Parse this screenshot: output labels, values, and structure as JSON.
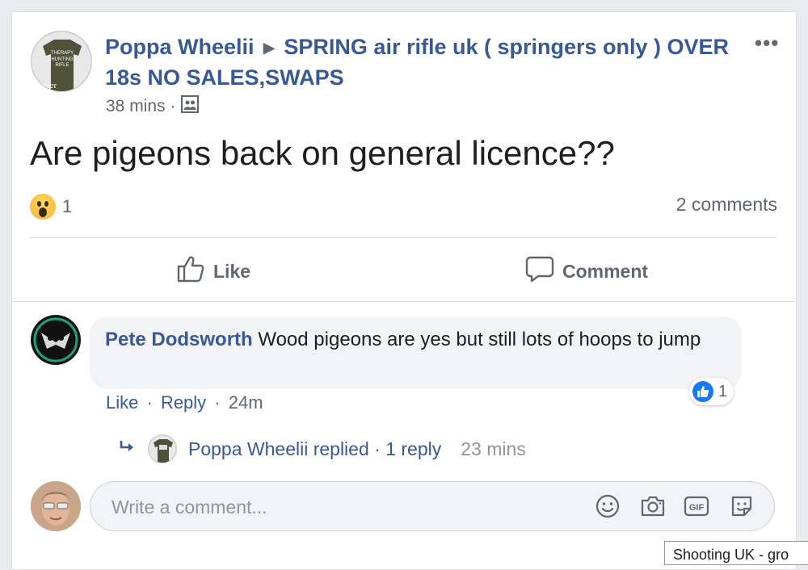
{
  "post": {
    "author": "Poppa Wheelii",
    "group": "SPRING air rifle uk ( springers only ) OVER 18s NO SALES,SWAPS",
    "time": "38 mins",
    "separator": "·",
    "text": "Are pigeons back on general licence??",
    "reaction_icon": "wow-emoji",
    "reaction_count": "1",
    "comment_count": "2 comments",
    "more_icon": "ellipsis-icon",
    "audience_icon": "group-members-icon",
    "author_avatar_text": [
      "THERAPY",
      "HUNTING",
      "RIFLE",
      "nter"
    ]
  },
  "actions": {
    "like_label": "Like",
    "comment_label": "Comment"
  },
  "comment": {
    "author": "Pete Dodsworth",
    "text": "Wood pigeons are yes but still lots of hoops to jump",
    "like_label": "Like",
    "reply_label": "Reply",
    "dot": "·",
    "time": "24m",
    "like_count": "1"
  },
  "reply": {
    "author": "Poppa Wheelii",
    "replied_label": "replied",
    "reply_count": "1 reply",
    "dot": "·",
    "time": "23 mins"
  },
  "composer": {
    "placeholder": "Write a comment...",
    "icons": [
      "emoji-icon",
      "camera-icon",
      "gif-icon",
      "sticker-icon"
    ]
  },
  "tooltip": {
    "text": "Shooting UK - gro"
  },
  "colors": {
    "link": "#385898",
    "secondary_text": "#606770",
    "like_blue": "#1877f2",
    "bubble_bg": "#f2f3f5"
  }
}
